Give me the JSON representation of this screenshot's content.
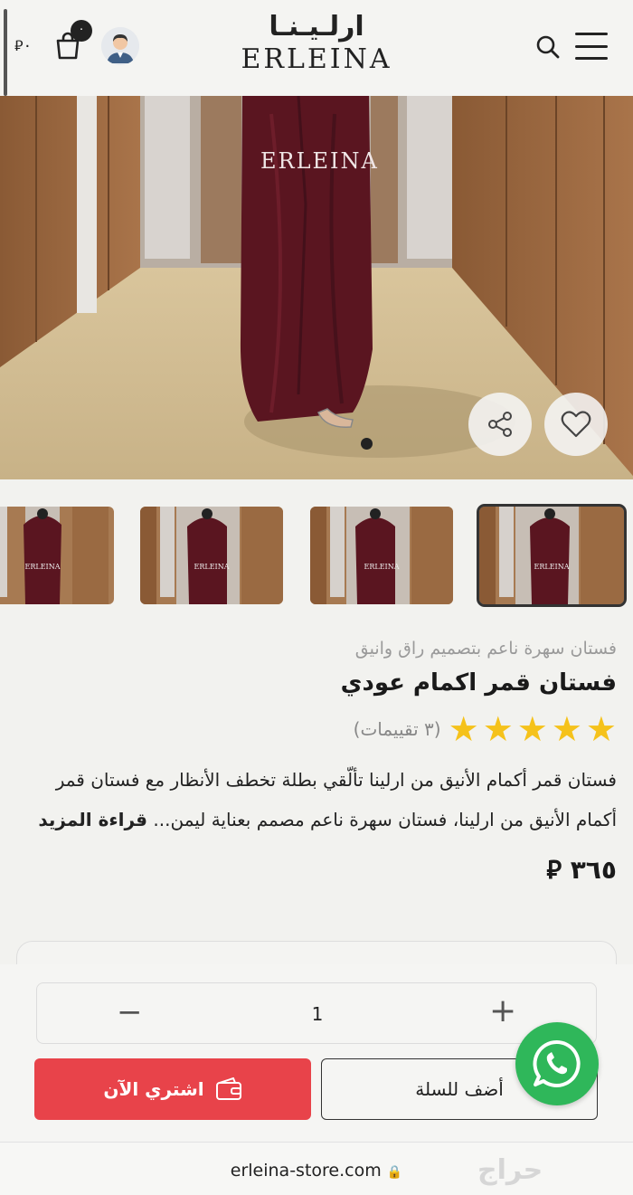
{
  "header": {
    "logo_ar": "ارلـيـنـا",
    "logo_en": "ERLEINA",
    "cart_count": "٠",
    "cart_total": "٠"
  },
  "hero": {
    "watermark": "ERLEINA",
    "current_slide": 1,
    "slide_count": 1
  },
  "thumbnails": [
    {
      "watermark": "ERLEINA"
    },
    {
      "watermark": "ERLEINA"
    },
    {
      "watermark": "ERLEINA"
    },
    {
      "watermark": "ERLEINA"
    }
  ],
  "product": {
    "subtitle": "فستان سهرة ناعم بتصميم راق وانيق",
    "title": "فستان قمر اكمام عودي",
    "rating": 5,
    "reviews_label": "(٣ تقييمات)",
    "description": "فستان قمر أكمام الأنيق من ارلينا تألّقي بطلة تخطف الأنظار مع فستان قمر أكمام الأنيق من ارلينا، فستان سهرة ناعم مصمم بعناية ليمن...",
    "read_more": "قراءة المزيد",
    "price": "٣٦٥"
  },
  "purchase": {
    "quantity": "1",
    "minus": "−",
    "plus": "+",
    "buy_now": "اشتري الآن",
    "add_to_cart": "أضف للسلة"
  },
  "browser": {
    "url": "erleina-store.com",
    "watermark": "حراج"
  },
  "colors": {
    "buy_now": "#e8434a",
    "star": "#f5c21b",
    "whatsapp": "#2fb75a",
    "dress": "#5a1520"
  }
}
